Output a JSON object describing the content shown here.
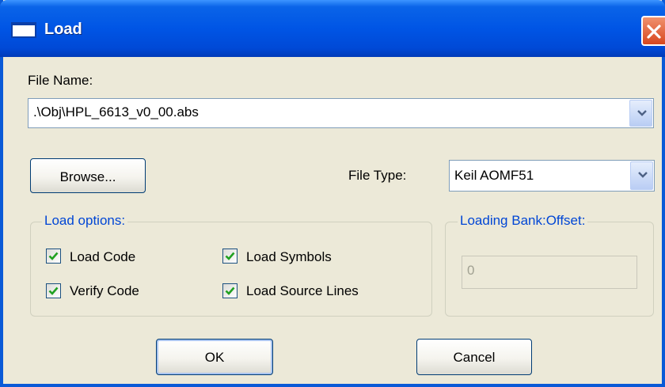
{
  "window": {
    "title": "Load",
    "close_icon": "close-icon"
  },
  "file_name": {
    "label": "File Name:",
    "value": ".\\Obj\\HPL_6613_v0_00.abs"
  },
  "browse_button": "Browse...",
  "file_type": {
    "label": "File Type:",
    "value": "Keil AOMF51"
  },
  "load_options": {
    "title": "Load options:",
    "items": [
      {
        "label": "Load Code",
        "checked": true
      },
      {
        "label": "Load Symbols",
        "checked": true
      },
      {
        "label": "Verify Code",
        "checked": true
      },
      {
        "label": "Load Source Lines",
        "checked": true
      }
    ]
  },
  "loading_bank": {
    "title": "Loading Bank:Offset:",
    "value": "0",
    "enabled": false
  },
  "buttons": {
    "ok": "OK",
    "cancel": "Cancel"
  },
  "colors": {
    "titlebar": "#0055e5",
    "dialog_bg": "#ece9d8",
    "group_title": "#0046d5",
    "close_button": "#d8471f",
    "checkmark": "#21a121"
  }
}
